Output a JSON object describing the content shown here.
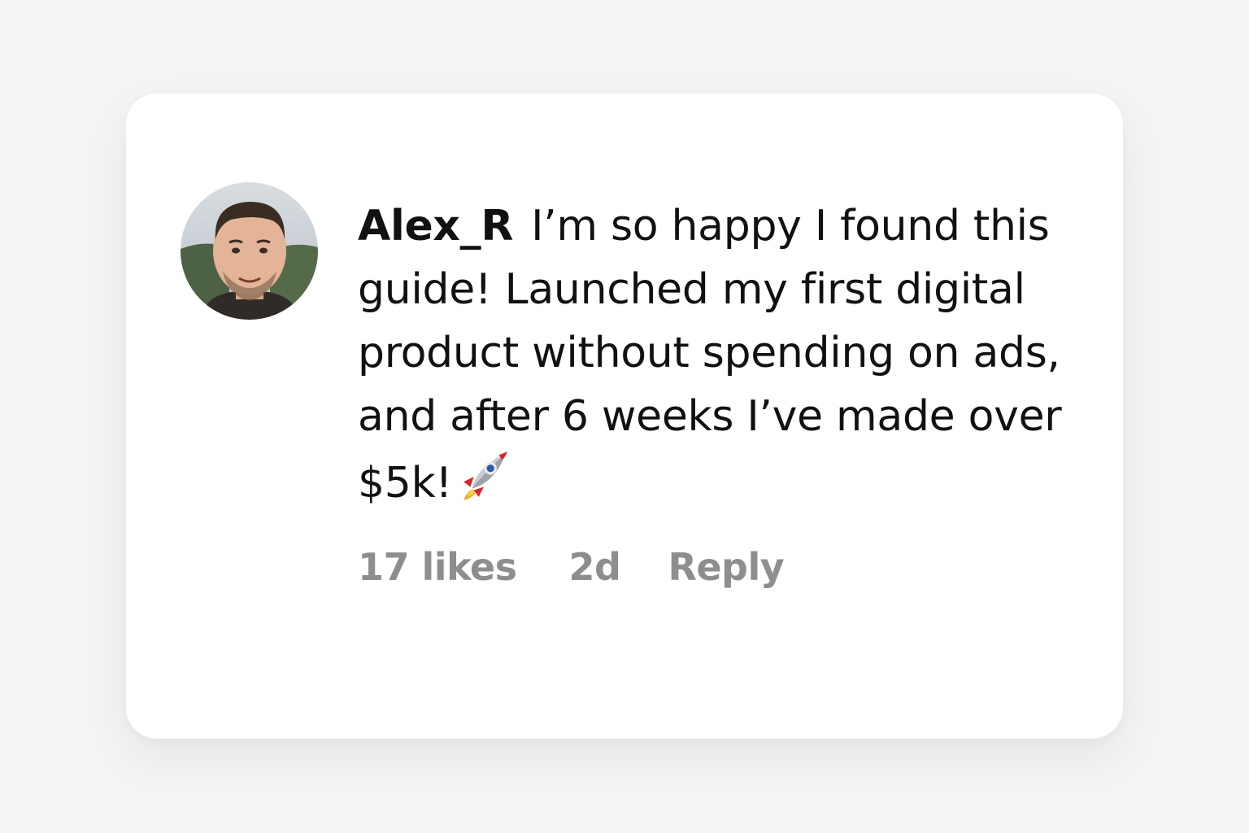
{
  "comment": {
    "username": "Alex_R",
    "text": "I’m so happy I found this guide! Launched my first digital product without spending on ads, and after 6 weeks I’ve made over $5k!",
    "emoji_icon": "rocket-icon",
    "likes": "17 likes",
    "time": "2d",
    "reply_label": "Reply"
  },
  "colors": {
    "background": "#f4f4f4",
    "card": "#ffffff",
    "text": "#111111",
    "meta_text": "#8e8e8e"
  }
}
